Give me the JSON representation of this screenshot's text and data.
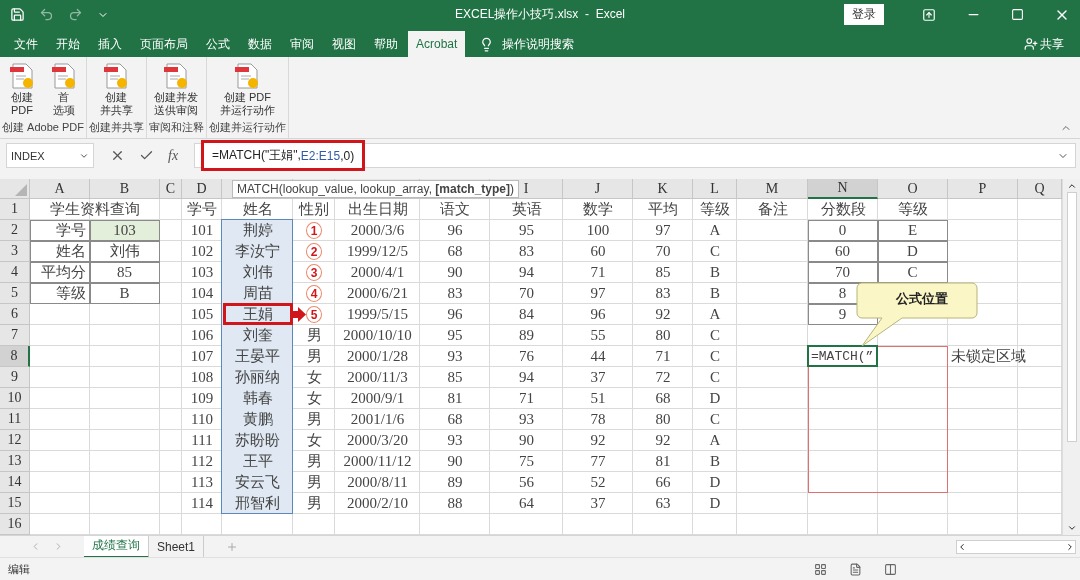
{
  "window": {
    "title": "EXCEL操作小技巧.xlsx  -  Excel",
    "sign_in": "登录"
  },
  "ribbon_tabs": [
    {
      "label": "文件",
      "selected": false
    },
    {
      "label": "开始",
      "selected": false
    },
    {
      "label": "插入",
      "selected": false
    },
    {
      "label": "页面布局",
      "selected": false
    },
    {
      "label": "公式",
      "selected": false
    },
    {
      "label": "数据",
      "selected": false
    },
    {
      "label": "审阅",
      "selected": false
    },
    {
      "label": "视图",
      "selected": false
    },
    {
      "label": "帮助",
      "selected": false
    },
    {
      "label": "Acrobat",
      "selected": true
    }
  ],
  "tell_me": "操作说明搜索",
  "share": "共享",
  "ribbon_groups": [
    {
      "label": "创建 Adobe PDF",
      "buttons": [
        {
          "lines": [
            "创建",
            "PDF"
          ]
        },
        {
          "lines": [
            "首",
            "选项"
          ]
        }
      ]
    },
    {
      "label": "创建并共享",
      "buttons": [
        {
          "lines": [
            "创建",
            "并共享"
          ]
        }
      ]
    },
    {
      "label": "审阅和注释",
      "buttons": [
        {
          "lines": [
            "创建并发",
            "送供审阅"
          ]
        }
      ]
    },
    {
      "label": "创建并运行动作",
      "buttons": [
        {
          "lines": [
            "创建 PDF",
            "并运行动作"
          ]
        }
      ]
    }
  ],
  "formula_bar": {
    "name_box": "INDEX",
    "function_button": "fx",
    "formula": [
      {
        "text": "=MATCH(\"王娟\",",
        "kind": "plain"
      },
      {
        "text": "E2:E15",
        "kind": "reference"
      },
      {
        "text": ",0)",
        "kind": "plain"
      }
    ]
  },
  "tooltip": "MATCH(lookup_value, lookup_array, **[match_type]**)",
  "sheet": {
    "columns": [
      {
        "header": "A",
        "selected": false
      },
      {
        "header": "B",
        "selected": false
      },
      {
        "header": "C",
        "selected": false
      },
      {
        "header": "D",
        "selected": false
      },
      {
        "selected": false
      },
      {
        "selected": false
      },
      {
        "selected": false
      },
      {
        "selected": false
      },
      {
        "header": "I",
        "selected": false
      },
      {
        "header": "J",
        "selected": false
      },
      {
        "header": "K",
        "selected": false
      },
      {
        "header": "L",
        "selected": false
      },
      {
        "header": "M",
        "selected": false
      },
      {
        "header": "N",
        "selected": true
      },
      {
        "header": "O",
        "selected": false
      },
      {
        "header": "P",
        "selected": false
      },
      {
        "header": "Q",
        "selected": false
      }
    ],
    "rows": [
      {
        "number": "1",
        "selected": false,
        "cells": [
          {
            "text": "学生资料查询",
            "merged": true
          },
          null,
          null,
          "学号",
          "姓名",
          "性别",
          "出生日期",
          "语文",
          "英语",
          "数学",
          "平均",
          "等级",
          "备注",
          "分数段",
          "等级",
          null,
          null
        ]
      },
      {
        "number": "2",
        "selected": false,
        "cells": [
          "学号",
          {
            "text": "103",
            "highlighted": true
          },
          null,
          "101",
          {
            "text": "荆婷",
            "selected": true
          },
          {
            "text": "1",
            "kind": "marker"
          },
          "2000/3/6",
          "96",
          "95",
          "100",
          "97",
          "A",
          null,
          "0",
          "E",
          null,
          null
        ]
      },
      {
        "number": "3",
        "selected": false,
        "cells": [
          "姓名",
          "刘伟",
          null,
          "102",
          {
            "text": "李汝宁",
            "selected": true
          },
          {
            "text": "2",
            "kind": "marker"
          },
          "1999/12/5",
          "68",
          "83",
          "60",
          "70",
          "C",
          null,
          "60",
          "D",
          null,
          null
        ]
      },
      {
        "number": "4",
        "selected": false,
        "cells": [
          "平均分",
          "85",
          null,
          "103",
          {
            "text": "刘伟",
            "selected": true
          },
          {
            "text": "3",
            "kind": "marker"
          },
          "2000/4/1",
          "90",
          "94",
          "71",
          "85",
          "B",
          null,
          "70",
          "C",
          null,
          null
        ]
      },
      {
        "number": "5",
        "selected": false,
        "cells": [
          "等级",
          "B",
          null,
          "104",
          {
            "text": "周苗",
            "selected": true
          },
          {
            "text": "4",
            "kind": "marker"
          },
          "2000/6/21",
          "83",
          "70",
          "97",
          "83",
          "B",
          null,
          "8",
          null,
          null,
          null
        ]
      },
      {
        "number": "6",
        "selected": false,
        "cells": [
          null,
          null,
          null,
          "105",
          {
            "text": "王娟",
            "selected": true,
            "marked": true
          },
          {
            "text": "5",
            "kind": "marker"
          },
          "1999/5/15",
          "96",
          "84",
          "96",
          "92",
          "A",
          null,
          "9",
          null,
          null,
          null
        ]
      },
      {
        "number": "7",
        "selected": false,
        "cells": [
          null,
          null,
          null,
          "106",
          {
            "text": "刘奎",
            "selected": true
          },
          "男",
          "2000/10/10",
          "95",
          "89",
          "55",
          "80",
          "C",
          null,
          null,
          null,
          null,
          null
        ]
      },
      {
        "number": "8",
        "selected": true,
        "cells": [
          null,
          null,
          null,
          "107",
          {
            "text": "王晏平",
            "selected": true
          },
          "男",
          "2000/1/28",
          "93",
          "76",
          "44",
          "71",
          "C",
          null,
          {
            "text": "=MATCH(”",
            "kind": "formula",
            "active": true
          },
          null,
          "未锁定区域",
          null
        ]
      },
      {
        "number": "9",
        "selected": false,
        "cells": [
          null,
          null,
          null,
          "108",
          {
            "text": "孙丽纳",
            "selected": true
          },
          "女",
          "2000/11/3",
          "85",
          "94",
          "37",
          "72",
          "C",
          null,
          null,
          null,
          null,
          null
        ]
      },
      {
        "number": "10",
        "selected": false,
        "cells": [
          null,
          null,
          null,
          "109",
          {
            "text": "韩春",
            "selected": true
          },
          "女",
          "2000/9/1",
          "81",
          "71",
          "51",
          "68",
          "D",
          null,
          null,
          null,
          null,
          null
        ]
      },
      {
        "number": "11",
        "selected": false,
        "cells": [
          null,
          null,
          null,
          "110",
          {
            "text": "黄鹏",
            "selected": true
          },
          "男",
          "2001/1/6",
          "68",
          "93",
          "78",
          "80",
          "C",
          null,
          null,
          null,
          null,
          null
        ]
      },
      {
        "number": "12",
        "selected": false,
        "cells": [
          null,
          null,
          null,
          "111",
          {
            "text": "苏盼盼",
            "selected": true
          },
          "女",
          "2000/3/20",
          "93",
          "90",
          "92",
          "92",
          "A",
          null,
          null,
          null,
          null,
          null
        ]
      },
      {
        "number": "13",
        "selected": false,
        "cells": [
          null,
          null,
          null,
          "112",
          {
            "text": "王平",
            "selected": true
          },
          "男",
          "2000/11/12",
          "90",
          "75",
          "77",
          "81",
          "B",
          null,
          null,
          null,
          null,
          null
        ]
      },
      {
        "number": "14",
        "selected": false,
        "cells": [
          null,
          null,
          null,
          "113",
          {
            "text": "安云飞",
            "selected": true
          },
          "男",
          "2000/8/11",
          "89",
          "56",
          "52",
          "66",
          "D",
          null,
          null,
          null,
          null,
          null
        ]
      },
      {
        "number": "15",
        "selected": false,
        "cells": [
          null,
          null,
          null,
          "114",
          {
            "text": "邢智利",
            "selected": true
          },
          "男",
          "2000/2/10",
          "88",
          "64",
          "37",
          "63",
          "D",
          null,
          null,
          null,
          null,
          null
        ]
      },
      {
        "number": "16",
        "selected": false
      }
    ]
  },
  "callout": "公式位置",
  "sheet_tabs": [
    {
      "label": "成绩查询",
      "selected": true
    },
    {
      "label": "Sheet1",
      "selected": false
    }
  ],
  "status": "编辑"
}
